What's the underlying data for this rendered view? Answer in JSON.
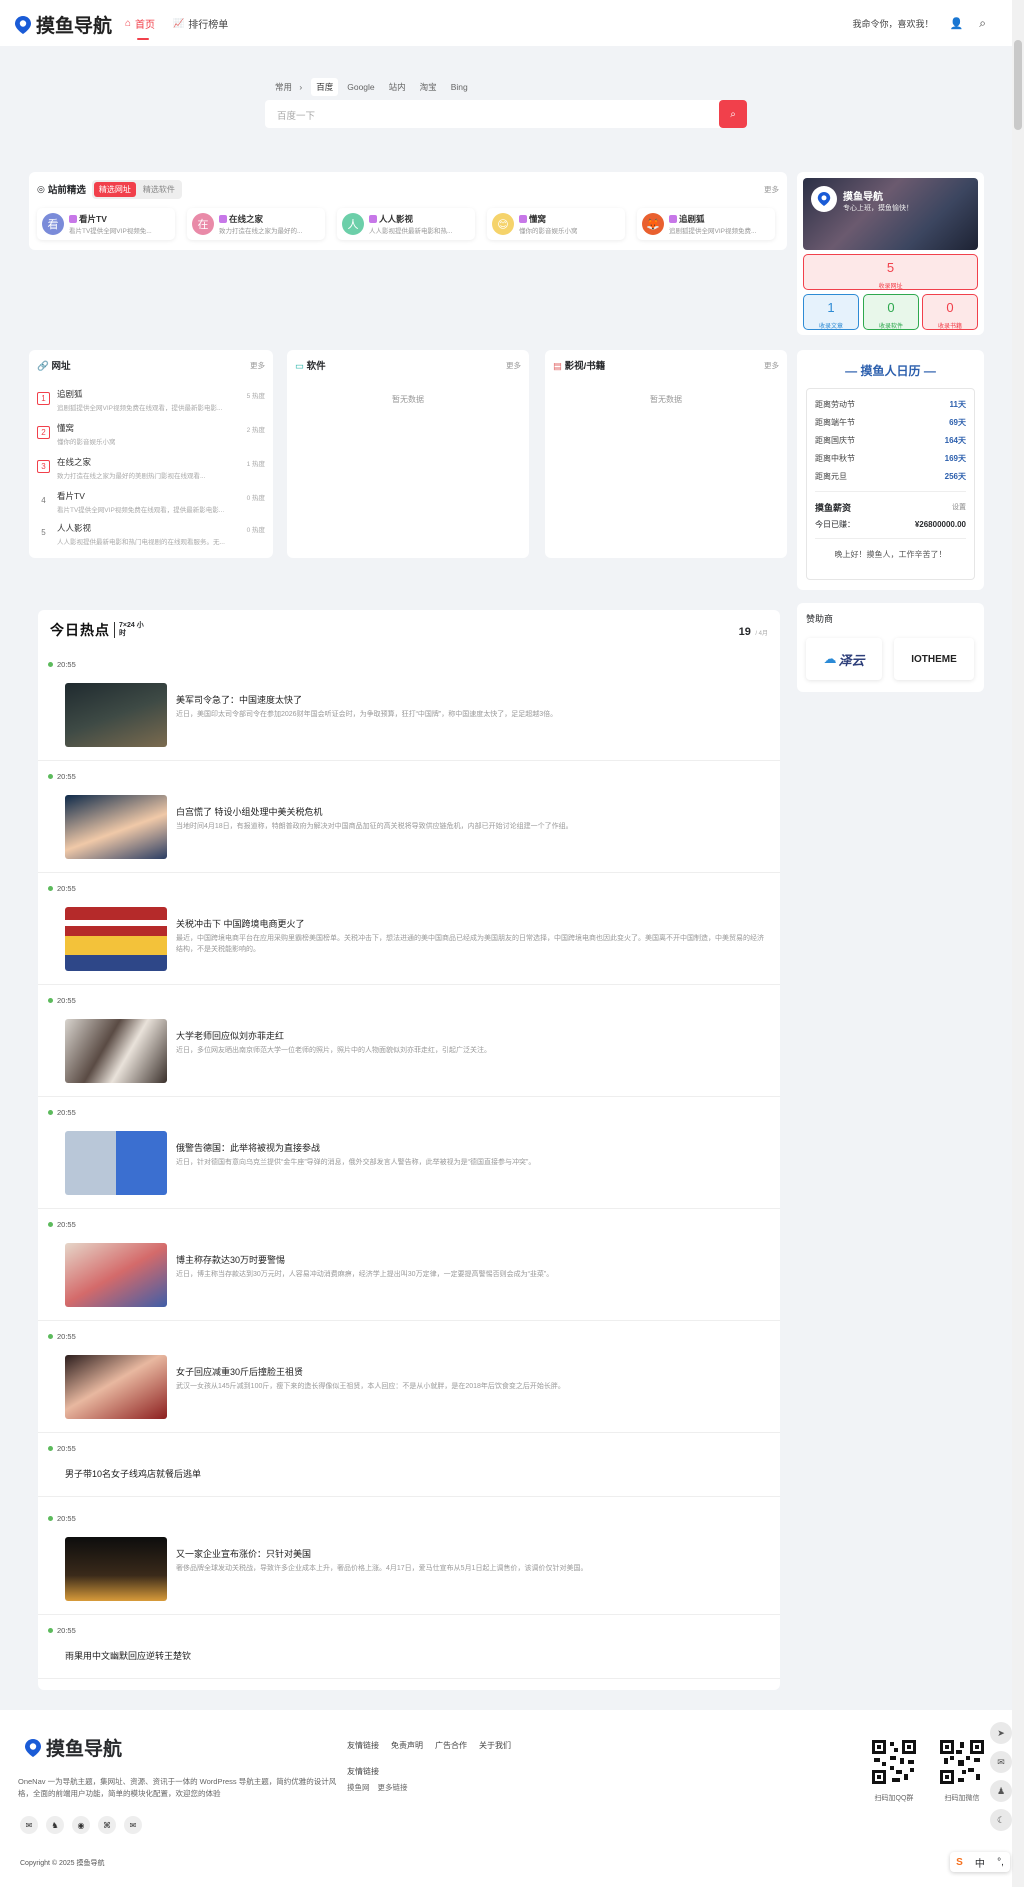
{
  "header": {
    "brand": "摸鱼导航",
    "nav": [
      {
        "label": "首页",
        "icon": "home-icon"
      },
      {
        "label": "排行榜单",
        "icon": "chart-icon"
      }
    ],
    "greeting": "我命令你，喜欢我！"
  },
  "search": {
    "tabs": [
      "常用",
      "百度",
      "Google",
      "站内",
      "淘宝",
      "Bing"
    ],
    "active_tab": "百度",
    "placeholder": "百度一下"
  },
  "featured": {
    "title": "站前精选",
    "tabs": [
      "精选网址",
      "精选软件"
    ],
    "more": "更多",
    "sites": [
      {
        "avatar": "看",
        "color": "#7a8bd9",
        "name": "看片TV",
        "desc": "看片TV提供全网VIP视频免..."
      },
      {
        "avatar": "在",
        "color": "#e98aa8",
        "name": "在线之家",
        "desc": "致力打造在线之家为最好的..."
      },
      {
        "avatar": "人",
        "color": "#6ccfa9",
        "name": "人人影视",
        "desc": "人人影视提供最新电影和热..."
      },
      {
        "avatar": "😊",
        "color": "#f5d36b",
        "name": "懂窝",
        "desc": "懂你的影音娱乐小窝"
      },
      {
        "avatar": "🦊",
        "color": "#e9602f",
        "name": "追剧狐",
        "desc": "追剧狐提供全网VIP视频免费..."
      }
    ]
  },
  "profile": {
    "name": "摸鱼导航",
    "tagline": "专心上班，摸鱼愉快！",
    "stats": [
      {
        "value": "5",
        "label": "收录网址",
        "color": "#f1404b",
        "bg": "#fde8e8"
      },
      {
        "value": "1",
        "label": "收录文章",
        "color": "#2e8bd4",
        "bg": "#e6f2fc"
      },
      {
        "value": "0",
        "label": "收录软件",
        "color": "#2ea84e",
        "bg": "#e8f7ea"
      },
      {
        "value": "0",
        "label": "收录书籍",
        "color": "#f1404b",
        "bg": "#fde8e8"
      }
    ]
  },
  "rankings": {
    "sites": {
      "title": "网址",
      "more": "更多",
      "items": [
        {
          "rank": "1",
          "title": "追剧狐",
          "desc": "追剧狐提供全网VIP视频免费在线观看，提供最新影电影...",
          "hot": "5 热度"
        },
        {
          "rank": "2",
          "title": "懂窝",
          "desc": "懂你的影音娱乐小窝",
          "hot": "2 热度"
        },
        {
          "rank": "3",
          "title": "在线之家",
          "desc": "致力打造在线之家为最好的美剧热门影视在线观看...",
          "hot": "1 热度"
        },
        {
          "rank": "4",
          "title": "看片TV",
          "desc": "看片TV提供全网VIP视频免费在线观看，提供最新影电影...",
          "hot": "0 热度"
        },
        {
          "rank": "5",
          "title": "人人影视",
          "desc": "人人影视提供最新电影和热门电视剧的在线观看服务。无...",
          "hot": "0 热度"
        }
      ]
    },
    "software": {
      "title": "软件",
      "more": "更多",
      "empty": "暂无数据"
    },
    "books": {
      "title": "影视/书籍",
      "more": "更多",
      "empty": "暂无数据"
    }
  },
  "calendar": {
    "title": "— 摸鱼人日历 —",
    "rows": [
      {
        "label": "距离劳动节",
        "value": "11天"
      },
      {
        "label": "距离端午节",
        "value": "69天"
      },
      {
        "label": "距离国庆节",
        "value": "164天"
      },
      {
        "label": "距离中秋节",
        "value": "169天"
      },
      {
        "label": "距离元旦",
        "value": "256天"
      }
    ],
    "salary_title": "摸鱼薪资",
    "salary_setting": "设置",
    "salary_label": "今日已赚：",
    "salary_value": "¥26800000.00",
    "greeting": "晚上好！摸鱼人，工作辛苦了！"
  },
  "sponsor": {
    "title": "赞助商",
    "items": [
      "泽云",
      "IOTHEME"
    ]
  },
  "hot": {
    "title": "今日热点",
    "badge": "7×24 小时",
    "day": "19",
    "month": "/ 4月",
    "items": [
      {
        "time": "20:55",
        "title": "美军司令急了：中国速度太快了",
        "desc": "近日，美国印太司令部司令在参加2026财年国会听证会时，为争取预算，狂打“中国牌”，称中国速度太快了，足足超越3倍。",
        "img": "military"
      },
      {
        "time": "20:55",
        "title": "白宫慌了 特设小组处理中美关税危机",
        "desc": "当地时间4月18日，有报道称，特朗普政府为解决对中国商品加征的高关税将导致供应链危机，内部已开始讨论组建一个了作组。",
        "img": "person"
      },
      {
        "time": "20:55",
        "title": "关税冲击下 中国跨境电商更火了",
        "desc": "最近，中国跨境电商平台在应用采购里霸榜美国榜单。关税冲击下，想法进通的美中国商品已经成为美国朋友的日常选择，中国跨境电商也因此变火了。美国离不开中国制造，中美贸易的经济结构，不是关税能影响的。",
        "img": "flag"
      },
      {
        "time": "20:55",
        "title": "大学老师回应似刘亦菲走红",
        "desc": "近日，多位网友晒出南京师范大学一位老师的照片，照片中的人物面貌似刘亦菲走红，引起广泛关注。",
        "img": "teacher"
      },
      {
        "time": "20:55",
        "title": "俄警告德国：此举将被视为直接参战",
        "desc": "近日，针对德国有意向乌克兰提供“金牛座”导弹的消息，俄外交部发言人警告称，此举被视为是“德国直接参与冲突”。",
        "img": "politics"
      },
      {
        "time": "20:55",
        "title": "博主称存款达30万时要警惕",
        "desc": "近日，博主称当存款达到30万元时，人容易冲动消费麻痹，经济学上提出叫30万定律，一定要提高警惕否则会成为“韭菜”。",
        "img": "money"
      },
      {
        "time": "20:55",
        "title": "女子回应减重30斤后撞脸王祖贤",
        "desc": "武汉一女孩从145斤减到100斤，瘦下来的造长得像似王祖贤，本人回应：不是从小就胖，是在2018年后饮食变之后开始长胖。",
        "img": "woman"
      },
      {
        "time": "20:55",
        "title": "男子带10名女子线鸡店就餐后逃单",
        "desc": "",
        "img": ""
      },
      {
        "time": "20:55",
        "title": "又一家企业宣布涨价：只针对美国",
        "desc": "奢侈品牌全球发动关税战，导致许多企业成本上升，奢品价格上涨。4月17日，爱马仕宣布从5月1日起上调售价，该调价仅针对美国。",
        "img": "hermes"
      },
      {
        "time": "20:55",
        "title": "雨果用中文幽默回应逆转王楚钦",
        "desc": "",
        "img": ""
      }
    ]
  },
  "footer": {
    "brand": "摸鱼导航",
    "desc": "OneNav 一为导航主题，集网址、资源、资讯于一体的 WordPress 导航主题，简约优雅的设计风格，全面的前端用户功能，简单的模块化配置，欢迎您的体验",
    "links": [
      "友情链接",
      "免责声明",
      "广告合作",
      "关于我们"
    ],
    "friend_title": "友情链接",
    "friend_links": [
      "摸鱼网",
      "更多链接"
    ],
    "qr": [
      "扫码加QQ群",
      "扫码加微信"
    ],
    "copyright": "Copyright © 2025 摸鱼导航"
  },
  "ime": {
    "label": "中"
  }
}
